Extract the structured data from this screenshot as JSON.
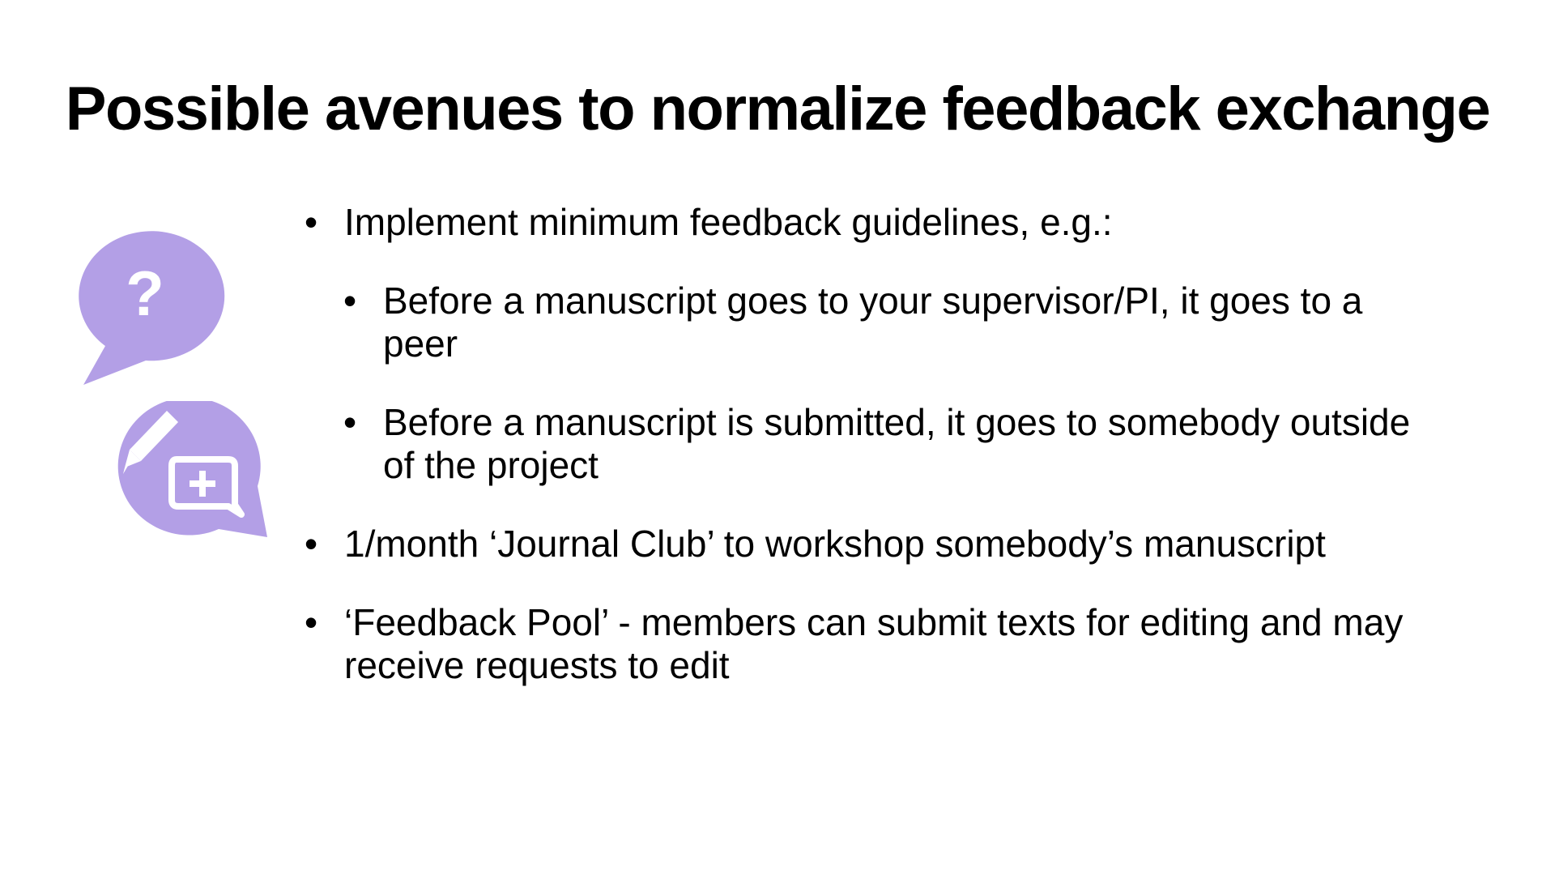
{
  "slide": {
    "title": "Possible avenues to normalize feedback exchange",
    "bullets": [
      {
        "level": 1,
        "lines": [
          "Implement minimum feedback guidelines, e.g.:"
        ]
      },
      {
        "level": 2,
        "lines": [
          "Before a manuscript goes to your supervisor/PI, it goes to a",
          "peer"
        ]
      },
      {
        "level": 2,
        "lines": [
          "Before a manuscript is submitted, it goes to somebody outside",
          "of the project"
        ]
      },
      {
        "level": 1,
        "lines": [
          "1/month ‘Journal Club’ to workshop somebody’s manuscript"
        ]
      },
      {
        "level": 1,
        "lines": [
          "‘Feedback Pool’ - members can submit texts for editing and may",
          "receive requests to edit"
        ]
      }
    ],
    "bullet_symbol": "•"
  },
  "icons": {
    "question_bubble": "question-speech-bubble-icon",
    "question_glyph": "?",
    "edit_bubble": "edit-comment-speech-bubble-icon"
  },
  "colors": {
    "accent": "#b39fe6",
    "icon_glyph": "#ffffff",
    "text": "#000000",
    "background": "#ffffff"
  }
}
